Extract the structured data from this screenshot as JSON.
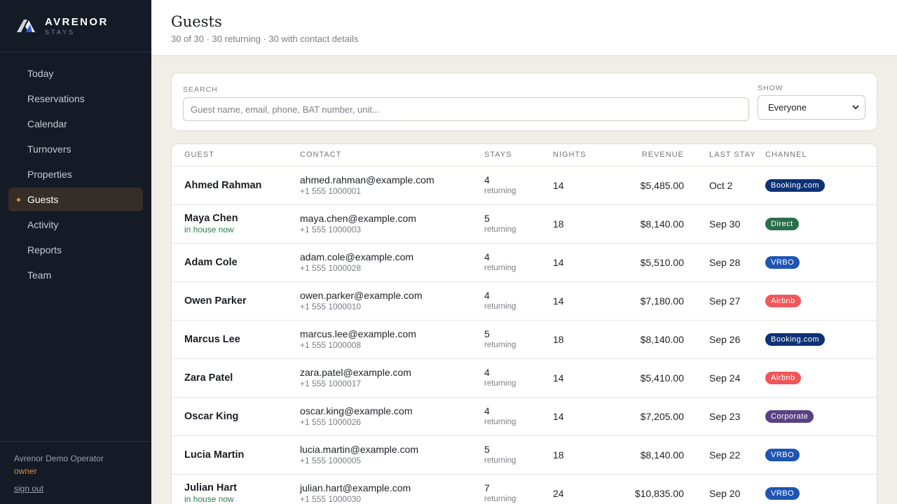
{
  "brand": {
    "name": "AVRENOR",
    "sub": "STAYS"
  },
  "nav": [
    {
      "label": "Today",
      "active": false
    },
    {
      "label": "Reservations",
      "active": false
    },
    {
      "label": "Calendar",
      "active": false
    },
    {
      "label": "Turnovers",
      "active": false
    },
    {
      "label": "Properties",
      "active": false
    },
    {
      "label": "Guests",
      "active": true
    },
    {
      "label": "Activity",
      "active": false
    },
    {
      "label": "Reports",
      "active": false
    },
    {
      "label": "Team",
      "active": false
    }
  ],
  "footer": {
    "operator": "Avrenor Demo Operator",
    "role": "owner",
    "signout": "sign out"
  },
  "header": {
    "title": "Guests",
    "subtitle": "30 of 30 · 30 returning · 30 with contact details"
  },
  "filters": {
    "search_label": "SEARCH",
    "search_placeholder": "Guest name, email, phone, BAT number, unit...",
    "search_value": "",
    "show_label": "SHOW",
    "show_value": "Everyone"
  },
  "table": {
    "columns": [
      "GUEST",
      "CONTACT",
      "STAYS",
      "NIGHTS",
      "REVENUE",
      "LAST STAY",
      "CHANNEL"
    ],
    "rows": [
      {
        "name": "Ahmed Rahman",
        "note": "",
        "email": "ahmed.rahman@example.com",
        "phone": "+1 555 1000001",
        "stays": "4",
        "stays_sub": "returning",
        "nights": "14",
        "revenue": "$5,485.00",
        "last_stay": "Oct 2",
        "channel": "Booking.com",
        "channel_key": "booking"
      },
      {
        "name": "Maya Chen",
        "note": "in house now",
        "email": "maya.chen@example.com",
        "phone": "+1 555 1000003",
        "stays": "5",
        "stays_sub": "returning",
        "nights": "18",
        "revenue": "$8,140.00",
        "last_stay": "Sep 30",
        "channel": "Direct",
        "channel_key": "direct"
      },
      {
        "name": "Adam Cole",
        "note": "",
        "email": "adam.cole@example.com",
        "phone": "+1 555 1000028",
        "stays": "4",
        "stays_sub": "returning",
        "nights": "14",
        "revenue": "$5,510.00",
        "last_stay": "Sep 28",
        "channel": "VRBO",
        "channel_key": "vrbo"
      },
      {
        "name": "Owen Parker",
        "note": "",
        "email": "owen.parker@example.com",
        "phone": "+1 555 1000010",
        "stays": "4",
        "stays_sub": "returning",
        "nights": "14",
        "revenue": "$7,180.00",
        "last_stay": "Sep 27",
        "channel": "Airbnb",
        "channel_key": "airbnb"
      },
      {
        "name": "Marcus Lee",
        "note": "",
        "email": "marcus.lee@example.com",
        "phone": "+1 555 1000008",
        "stays": "5",
        "stays_sub": "returning",
        "nights": "18",
        "revenue": "$8,140.00",
        "last_stay": "Sep 26",
        "channel": "Booking.com",
        "channel_key": "booking"
      },
      {
        "name": "Zara Patel",
        "note": "",
        "email": "zara.patel@example.com",
        "phone": "+1 555 1000017",
        "stays": "4",
        "stays_sub": "returning",
        "nights": "14",
        "revenue": "$5,410.00",
        "last_stay": "Sep 24",
        "channel": "Airbnb",
        "channel_key": "airbnb"
      },
      {
        "name": "Oscar King",
        "note": "",
        "email": "oscar.king@example.com",
        "phone": "+1 555 1000026",
        "stays": "4",
        "stays_sub": "returning",
        "nights": "14",
        "revenue": "$7,205.00",
        "last_stay": "Sep 23",
        "channel": "Corporate",
        "channel_key": "corporate"
      },
      {
        "name": "Lucia Martin",
        "note": "",
        "email": "lucia.martin@example.com",
        "phone": "+1 555 1000005",
        "stays": "5",
        "stays_sub": "returning",
        "nights": "18",
        "revenue": "$8,140.00",
        "last_stay": "Sep 22",
        "channel": "VRBO",
        "channel_key": "vrbo"
      },
      {
        "name": "Julian Hart",
        "note": "in house now",
        "email": "julian.hart@example.com",
        "phone": "+1 555 1000030",
        "stays": "7",
        "stays_sub": "returning",
        "nights": "24",
        "revenue": "$10,835.00",
        "last_stay": "Sep 20",
        "channel": "VRBO",
        "channel_key": "vrbo"
      }
    ]
  },
  "colors": {
    "sidebar_bg": "#141b26",
    "accent": "#d9913a",
    "page_bg": "#f1ede7",
    "in_house": "#2f7a4b"
  }
}
